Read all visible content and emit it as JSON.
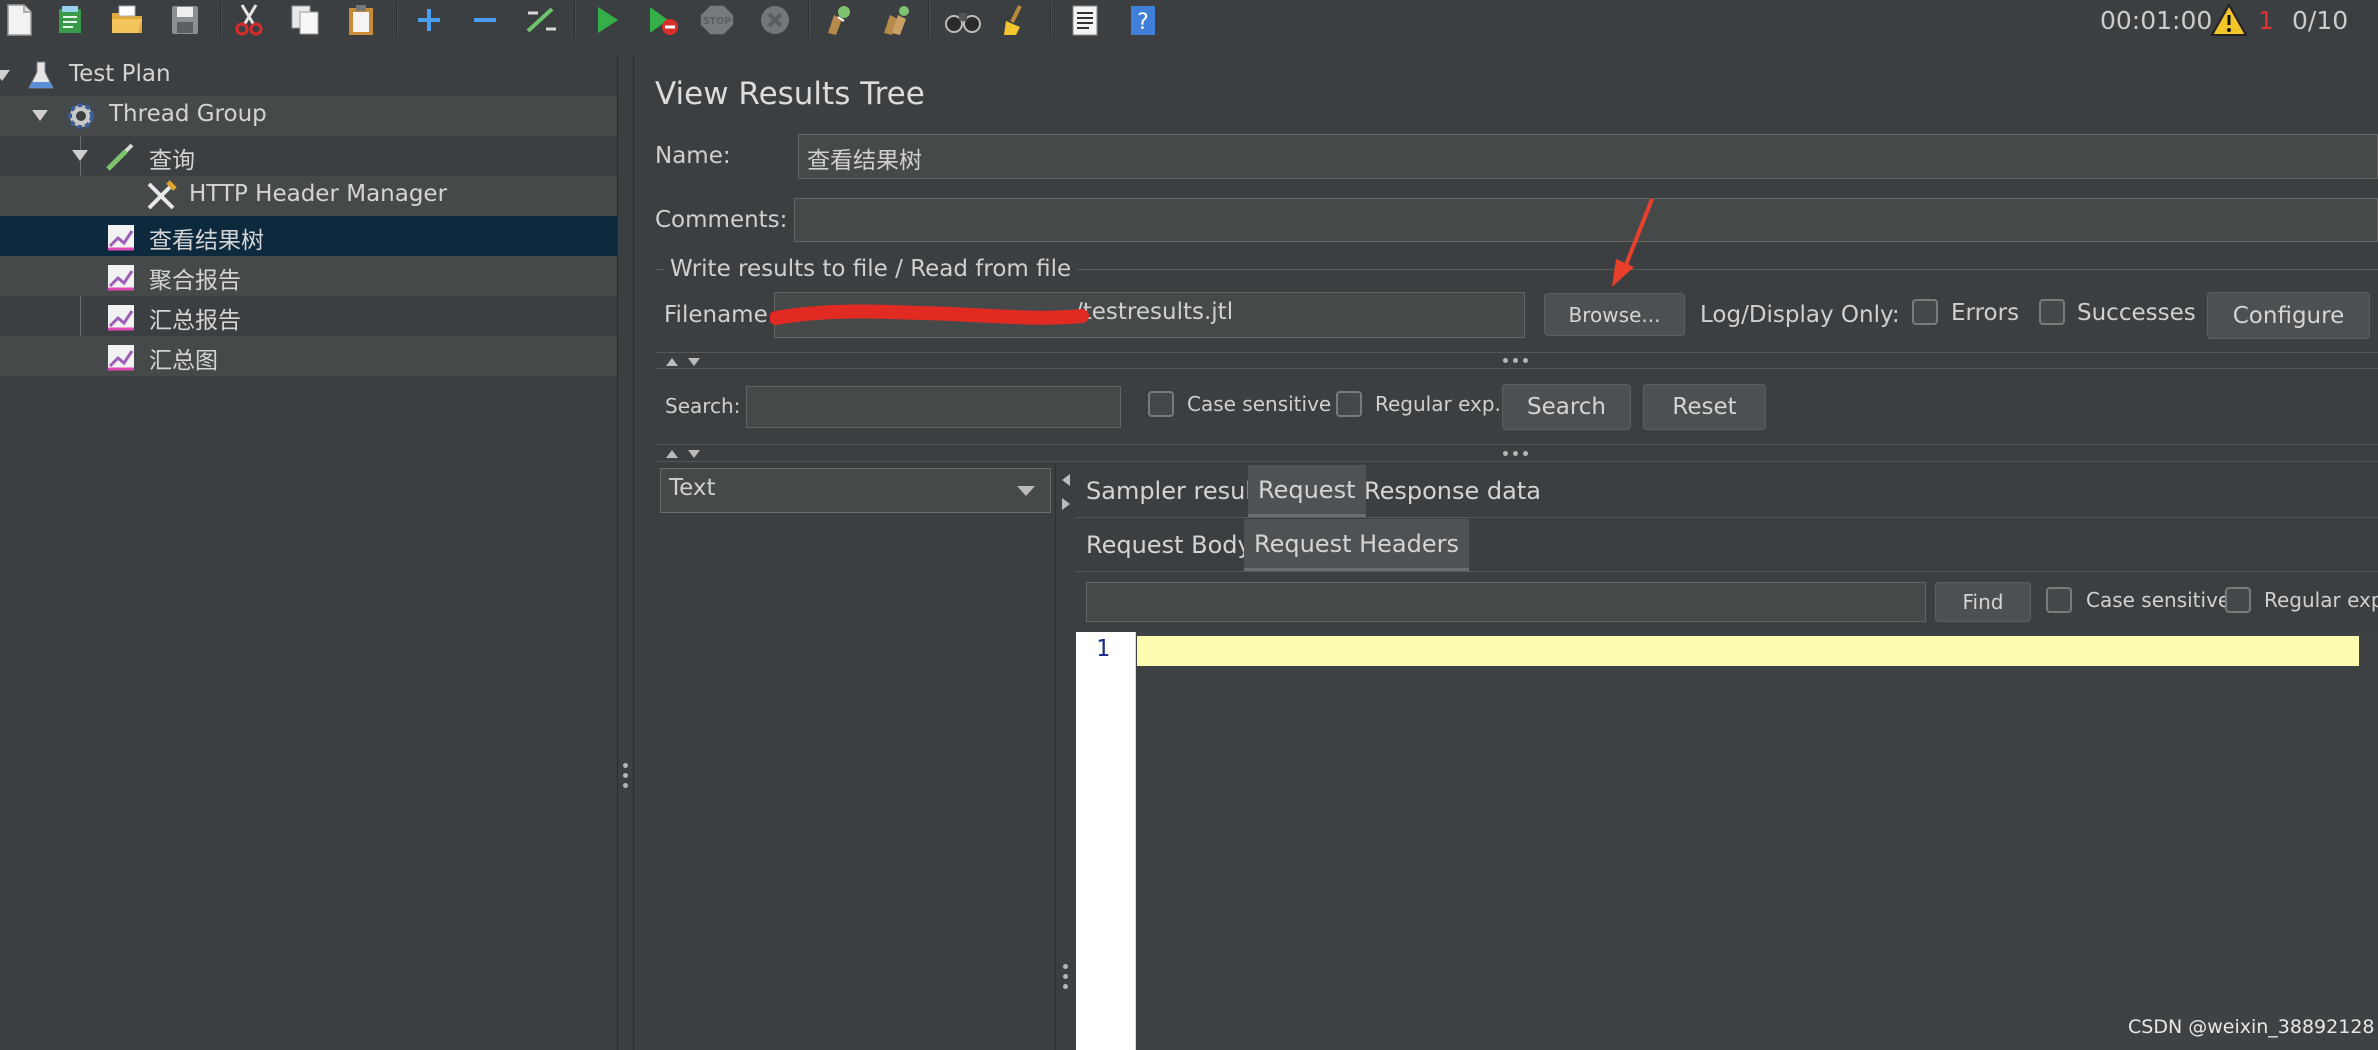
{
  "toolbar": {
    "timer": "00:01:00",
    "warning_count": "1",
    "threads": "0/10",
    "stop_label": "STOP"
  },
  "tree": {
    "items": [
      {
        "label": "Test Plan"
      },
      {
        "label": "Thread Group"
      },
      {
        "label": "查询"
      },
      {
        "label": "HTTP Header Manager"
      },
      {
        "label": "查看结果树"
      },
      {
        "label": "聚合报告"
      },
      {
        "label": "汇总报告"
      },
      {
        "label": "汇总图"
      }
    ]
  },
  "panel": {
    "title": "View Results Tree",
    "name_label": "Name:",
    "name_value": "查看结果树",
    "comments_label": "Comments:",
    "comments_value": "",
    "file_group_title": "Write results to file / Read from file",
    "filename_label": "Filename",
    "filename_value": "/testresults.jtl",
    "browse_label": "Browse...",
    "log_display_label": "Log/Display Only:",
    "errors_label": "Errors",
    "successes_label": "Successes",
    "configure_label": "Configure"
  },
  "search": {
    "label": "Search:",
    "value": "",
    "case_sensitive": "Case sensitive",
    "regular_exp": "Regular exp.",
    "search_button": "Search",
    "reset_button": "Reset"
  },
  "results": {
    "renderer_selected": "Text",
    "main_tabs": [
      "Sampler result",
      "Request",
      "Response data"
    ],
    "active_main_tab": "Request",
    "sub_tabs": [
      "Request Body",
      "Request Headers"
    ],
    "active_sub_tab": "Request Headers",
    "find_value": "",
    "find_button": "Find",
    "case_sensitive": "Case sensitive",
    "regular_exp": "Regular exp.",
    "line_number": "1"
  },
  "watermark": "CSDN @weixin_38892128",
  "colors": {
    "background": "#3c3f41",
    "selection": "#0d293e",
    "editor_current_line": "#fdfbb0",
    "annotation_arrow": "#e8402a",
    "redaction": "#e02a22"
  }
}
